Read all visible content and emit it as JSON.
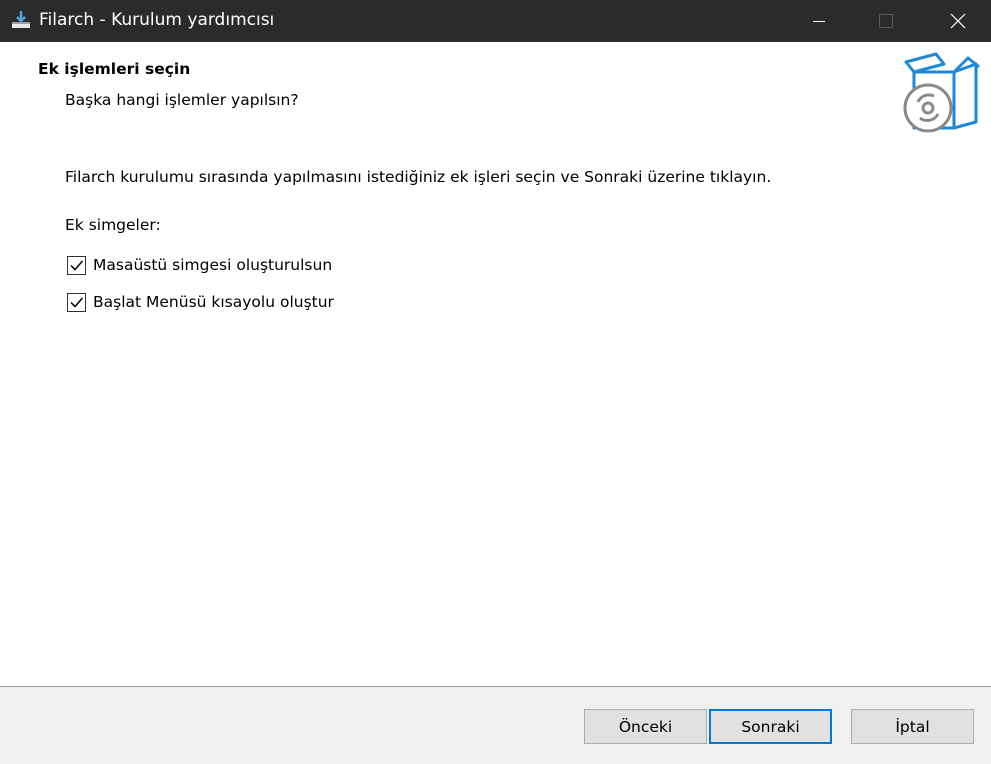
{
  "window": {
    "title": "Filarch - Kurulum yardımcısı",
    "icon": "installer-icon",
    "controls": [
      "minimize-icon",
      "maximize-icon",
      "close-icon"
    ]
  },
  "header": {
    "title": "Ek işlemleri seçin",
    "subtitle": "Başka hangi işlemler yapılsın?",
    "image": "software-box-disc-icon"
  },
  "content": {
    "instructions": "Filarch kurulumu sırasında yapılmasını istediğiniz ek işleri seçin ve Sonraki üzerine tıklayın.",
    "group_label": "Ek simgeler:",
    "tasks": [
      {
        "label": "Masaüstü simgesi oluşturulsun",
        "checked": true
      },
      {
        "label": "Başlat Menüsü kısayolu oluştur",
        "checked": true
      }
    ]
  },
  "buttons": {
    "back": "Önceki",
    "next": "Sonraki",
    "cancel": "İptal"
  },
  "colors": {
    "titlebar": "#2b2b2b",
    "footer": "#f0f0f0",
    "accent": "#0078d7",
    "box_icon": "#1e88d8"
  }
}
